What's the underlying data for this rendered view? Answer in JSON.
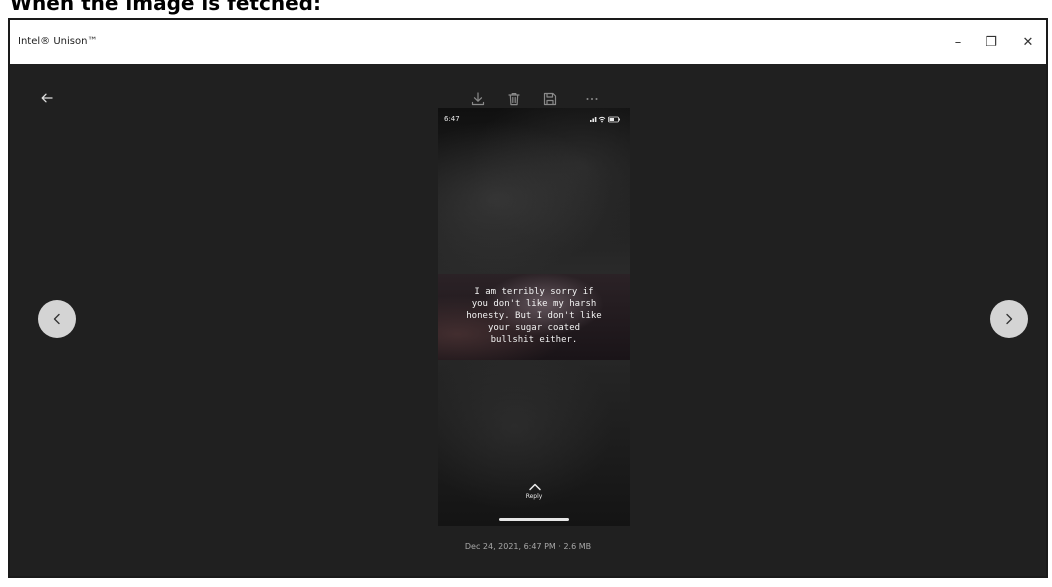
{
  "caption": "When the image is fetched:",
  "window": {
    "title": "Intel® Unison™",
    "controls": {
      "minimize": "–",
      "restore": "❐",
      "close": "✕"
    }
  },
  "toolbar": {
    "icons": [
      "back-arrow-icon",
      "download-icon",
      "delete-icon",
      "save-icon",
      "more-icon"
    ]
  },
  "photo": {
    "status_time": "6:47",
    "story_text": "I am terribly sorry if\nyou don't like my harsh\nhonesty. But I don't like\nyour sugar coated\nbullshit either.",
    "reply_label": "Reply"
  },
  "meta": "Dec 24, 2021, 6:47 PM · 2.6 MB",
  "colors": {
    "window_bg": "#202020",
    "nav_button": "#d4d4d4",
    "icon_gray": "#8a8a8a"
  }
}
